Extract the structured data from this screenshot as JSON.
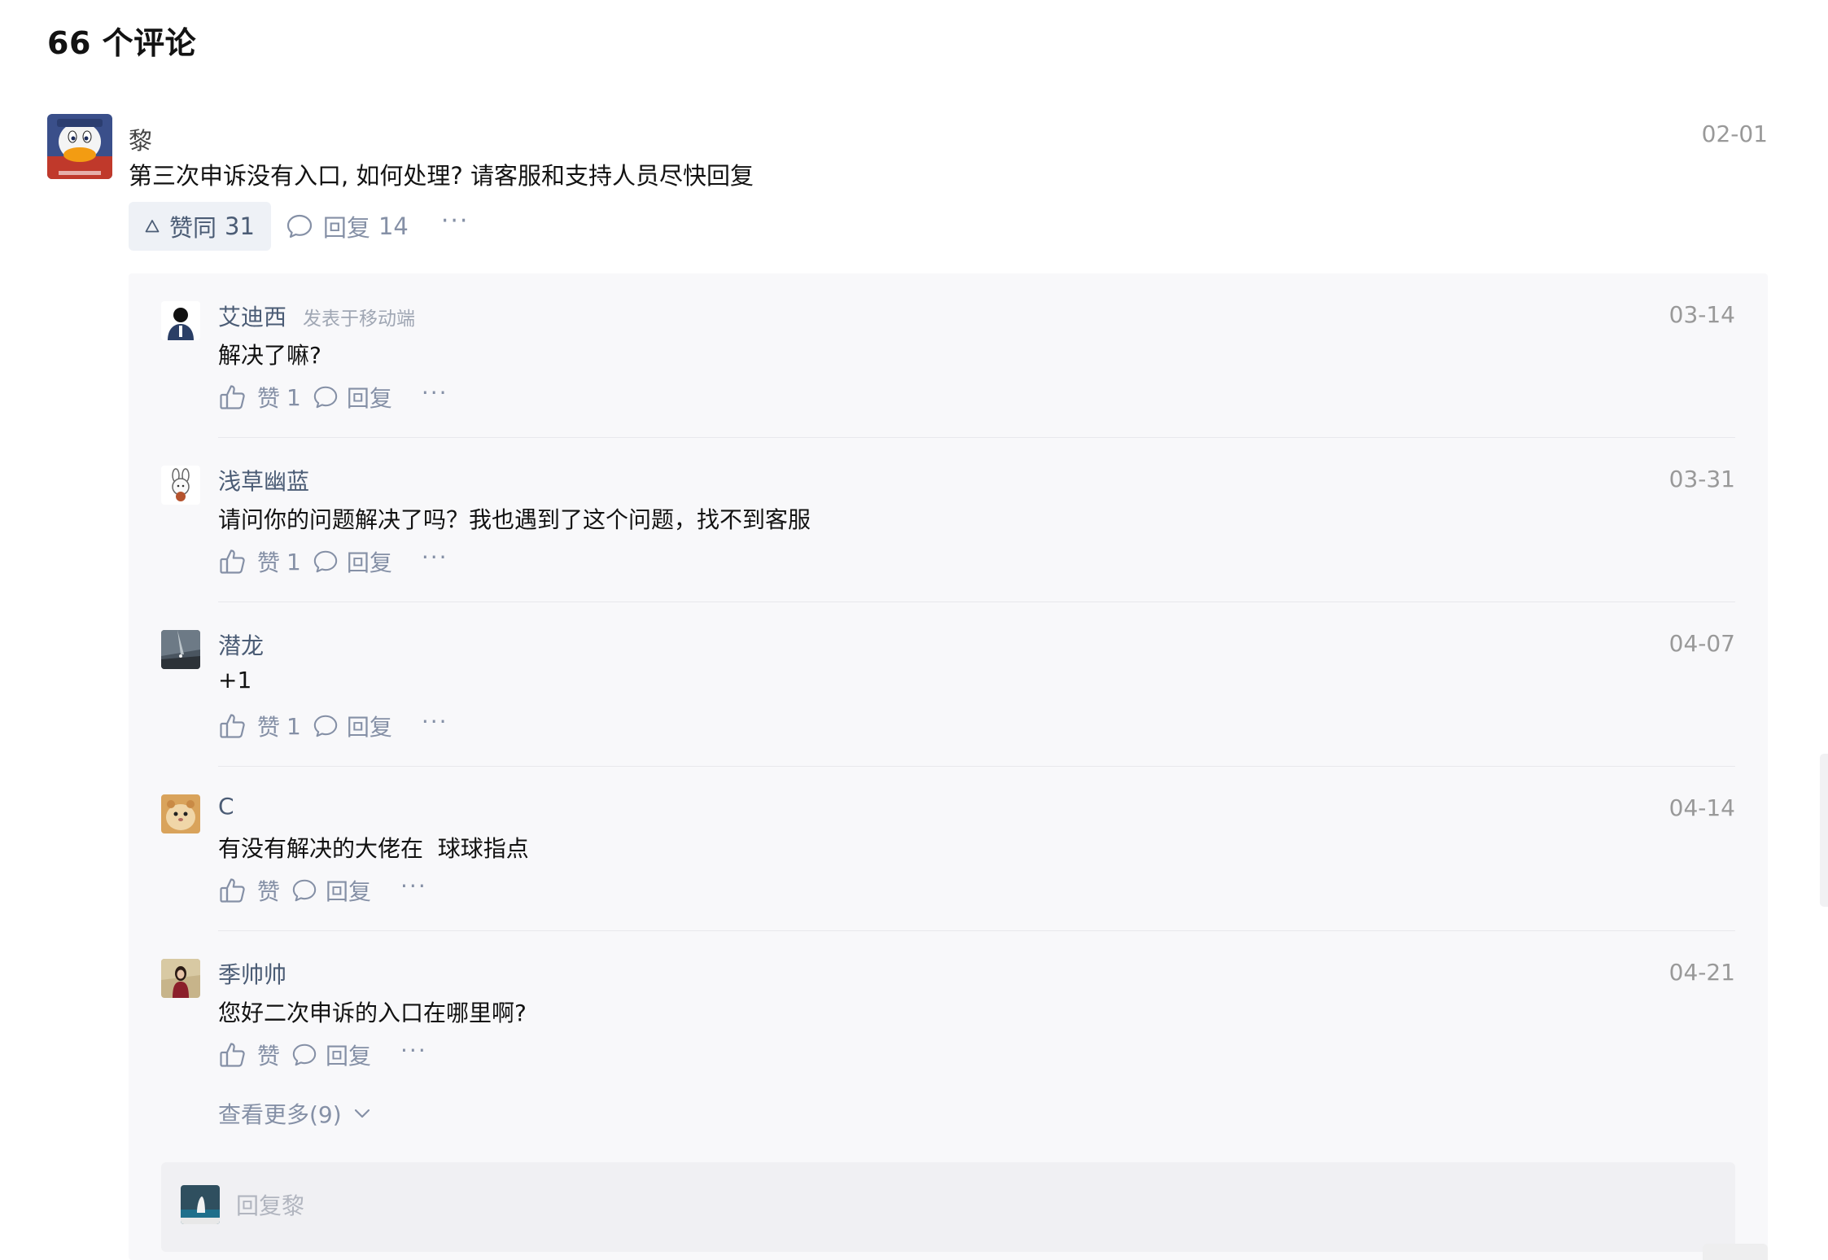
{
  "page": {
    "title": "66 个评论"
  },
  "top_comment": {
    "author": "黎",
    "date": "02-01",
    "content": "第三次申诉没有入口, 如何处理? 请客服和支持人员尽快回复",
    "agree_label": "赞同",
    "agree_count": "31",
    "reply_label": "回复",
    "reply_count": "14",
    "more_label": "···",
    "avatar": "cartoon-duck-avatar"
  },
  "replies": [
    {
      "author": "艾迪西",
      "device": "发表于移动端",
      "date": "03-14",
      "content": "解决了嘛?",
      "like_label": "赞",
      "like_count": "1",
      "reply_label": "回复",
      "more_label": "···",
      "avatar": "silhouette-avatar"
    },
    {
      "author": "浅草幽蓝",
      "device": "",
      "date": "03-31",
      "content": "请问你的问题解决了吗？我也遇到了这个问题，找不到客服",
      "like_label": "赞",
      "like_count": "1",
      "reply_label": "回复",
      "more_label": "···",
      "avatar": "sketch-bunny-avatar"
    },
    {
      "author": "潜龙",
      "device": "",
      "date": "04-07",
      "content": "+1",
      "like_label": "赞",
      "like_count": "1",
      "reply_label": "回复",
      "more_label": "···",
      "avatar": "night-sky-avatar"
    },
    {
      "author": "C",
      "device": "",
      "date": "04-14",
      "content": "有没有解决的大佬在  球球指点",
      "like_label": "赞",
      "like_count": "",
      "reply_label": "回复",
      "more_label": "···",
      "avatar": "hamster-avatar"
    },
    {
      "author": "季帅帅",
      "device": "",
      "date": "04-21",
      "content": "您好二次申诉的入口在哪里啊?",
      "like_label": "赞",
      "like_count": "",
      "reply_label": "回复",
      "more_label": "···",
      "avatar": "portrait-avatar"
    }
  ],
  "view_more": {
    "label": "查看更多(9)"
  },
  "reply_box": {
    "placeholder": "回复黎",
    "avatar": "landscape-avatar"
  },
  "colors": {
    "name_blue": "#4b5c75",
    "meta_gray": "#8590a6",
    "date_gray": "#999999",
    "panel_bg": "#f8f8fa",
    "agree_bg": "#eef1f6"
  }
}
